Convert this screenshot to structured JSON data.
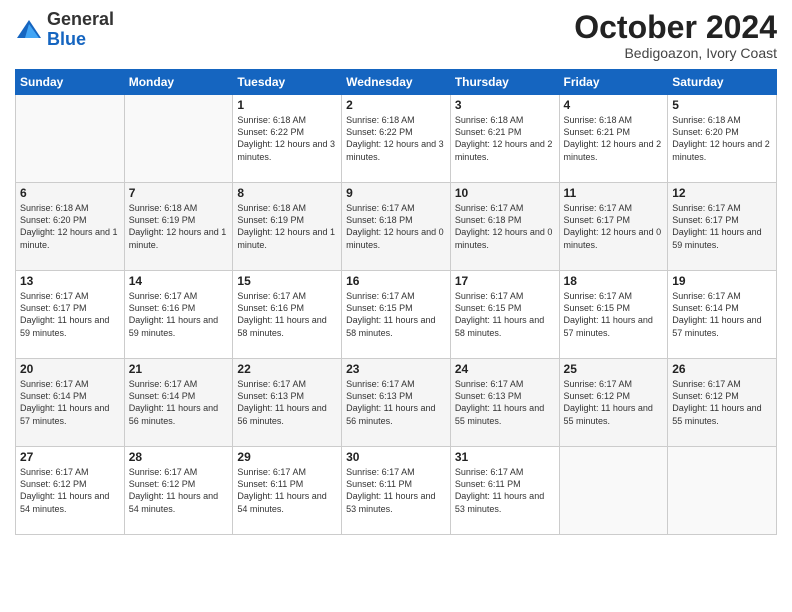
{
  "header": {
    "logo_general": "General",
    "logo_blue": "Blue",
    "month_title": "October 2024",
    "location": "Bedigoazon, Ivory Coast"
  },
  "days_of_week": [
    "Sunday",
    "Monday",
    "Tuesday",
    "Wednesday",
    "Thursday",
    "Friday",
    "Saturday"
  ],
  "weeks": [
    [
      {
        "day": "",
        "info": ""
      },
      {
        "day": "",
        "info": ""
      },
      {
        "day": "1",
        "info": "Sunrise: 6:18 AM\nSunset: 6:22 PM\nDaylight: 12 hours and 3 minutes."
      },
      {
        "day": "2",
        "info": "Sunrise: 6:18 AM\nSunset: 6:22 PM\nDaylight: 12 hours and 3 minutes."
      },
      {
        "day": "3",
        "info": "Sunrise: 6:18 AM\nSunset: 6:21 PM\nDaylight: 12 hours and 2 minutes."
      },
      {
        "day": "4",
        "info": "Sunrise: 6:18 AM\nSunset: 6:21 PM\nDaylight: 12 hours and 2 minutes."
      },
      {
        "day": "5",
        "info": "Sunrise: 6:18 AM\nSunset: 6:20 PM\nDaylight: 12 hours and 2 minutes."
      }
    ],
    [
      {
        "day": "6",
        "info": "Sunrise: 6:18 AM\nSunset: 6:20 PM\nDaylight: 12 hours and 1 minute."
      },
      {
        "day": "7",
        "info": "Sunrise: 6:18 AM\nSunset: 6:19 PM\nDaylight: 12 hours and 1 minute."
      },
      {
        "day": "8",
        "info": "Sunrise: 6:18 AM\nSunset: 6:19 PM\nDaylight: 12 hours and 1 minute."
      },
      {
        "day": "9",
        "info": "Sunrise: 6:17 AM\nSunset: 6:18 PM\nDaylight: 12 hours and 0 minutes."
      },
      {
        "day": "10",
        "info": "Sunrise: 6:17 AM\nSunset: 6:18 PM\nDaylight: 12 hours and 0 minutes."
      },
      {
        "day": "11",
        "info": "Sunrise: 6:17 AM\nSunset: 6:17 PM\nDaylight: 12 hours and 0 minutes."
      },
      {
        "day": "12",
        "info": "Sunrise: 6:17 AM\nSunset: 6:17 PM\nDaylight: 11 hours and 59 minutes."
      }
    ],
    [
      {
        "day": "13",
        "info": "Sunrise: 6:17 AM\nSunset: 6:17 PM\nDaylight: 11 hours and 59 minutes."
      },
      {
        "day": "14",
        "info": "Sunrise: 6:17 AM\nSunset: 6:16 PM\nDaylight: 11 hours and 59 minutes."
      },
      {
        "day": "15",
        "info": "Sunrise: 6:17 AM\nSunset: 6:16 PM\nDaylight: 11 hours and 58 minutes."
      },
      {
        "day": "16",
        "info": "Sunrise: 6:17 AM\nSunset: 6:15 PM\nDaylight: 11 hours and 58 minutes."
      },
      {
        "day": "17",
        "info": "Sunrise: 6:17 AM\nSunset: 6:15 PM\nDaylight: 11 hours and 58 minutes."
      },
      {
        "day": "18",
        "info": "Sunrise: 6:17 AM\nSunset: 6:15 PM\nDaylight: 11 hours and 57 minutes."
      },
      {
        "day": "19",
        "info": "Sunrise: 6:17 AM\nSunset: 6:14 PM\nDaylight: 11 hours and 57 minutes."
      }
    ],
    [
      {
        "day": "20",
        "info": "Sunrise: 6:17 AM\nSunset: 6:14 PM\nDaylight: 11 hours and 57 minutes."
      },
      {
        "day": "21",
        "info": "Sunrise: 6:17 AM\nSunset: 6:14 PM\nDaylight: 11 hours and 56 minutes."
      },
      {
        "day": "22",
        "info": "Sunrise: 6:17 AM\nSunset: 6:13 PM\nDaylight: 11 hours and 56 minutes."
      },
      {
        "day": "23",
        "info": "Sunrise: 6:17 AM\nSunset: 6:13 PM\nDaylight: 11 hours and 56 minutes."
      },
      {
        "day": "24",
        "info": "Sunrise: 6:17 AM\nSunset: 6:13 PM\nDaylight: 11 hours and 55 minutes."
      },
      {
        "day": "25",
        "info": "Sunrise: 6:17 AM\nSunset: 6:12 PM\nDaylight: 11 hours and 55 minutes."
      },
      {
        "day": "26",
        "info": "Sunrise: 6:17 AM\nSunset: 6:12 PM\nDaylight: 11 hours and 55 minutes."
      }
    ],
    [
      {
        "day": "27",
        "info": "Sunrise: 6:17 AM\nSunset: 6:12 PM\nDaylight: 11 hours and 54 minutes."
      },
      {
        "day": "28",
        "info": "Sunrise: 6:17 AM\nSunset: 6:12 PM\nDaylight: 11 hours and 54 minutes."
      },
      {
        "day": "29",
        "info": "Sunrise: 6:17 AM\nSunset: 6:11 PM\nDaylight: 11 hours and 54 minutes."
      },
      {
        "day": "30",
        "info": "Sunrise: 6:17 AM\nSunset: 6:11 PM\nDaylight: 11 hours and 53 minutes."
      },
      {
        "day": "31",
        "info": "Sunrise: 6:17 AM\nSunset: 6:11 PM\nDaylight: 11 hours and 53 minutes."
      },
      {
        "day": "",
        "info": ""
      },
      {
        "day": "",
        "info": ""
      }
    ]
  ]
}
